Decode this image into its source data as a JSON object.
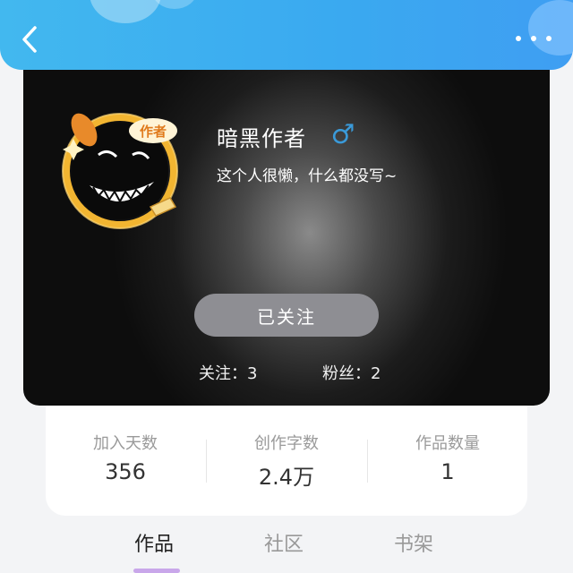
{
  "header": {
    "back_icon": "chevron-left-icon",
    "more_icon": "more-horizontal-icon"
  },
  "profile": {
    "name": "暗黑作者",
    "gender_symbol": "♂",
    "gender_color": "#3a9ad9",
    "bio": "这个人很懒，什么都没写~",
    "badge_text": "作者",
    "follow_button_label": "已关注",
    "following": "关注：3",
    "fans": "粉丝：2"
  },
  "stats": [
    {
      "label": "加入天数",
      "value": "356"
    },
    {
      "label": "创作字数",
      "value": "2.4万"
    },
    {
      "label": "作品数量",
      "value": "1"
    }
  ],
  "tabs": [
    {
      "label": "作品",
      "active": true
    },
    {
      "label": "社区",
      "active": false
    },
    {
      "label": "书架",
      "active": false
    }
  ],
  "colors": {
    "header_blue": "#3aa9f0",
    "follow_button": "#8e8e93",
    "tab_indicator": "#c9a7ea"
  }
}
